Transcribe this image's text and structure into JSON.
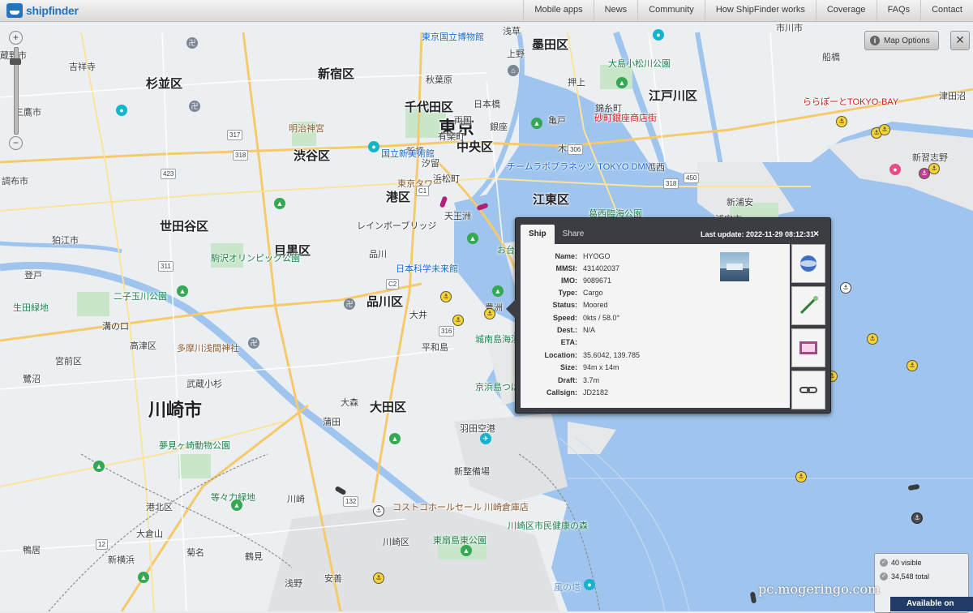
{
  "header": {
    "logo_text": "shipfinder",
    "nav": [
      "Mobile apps",
      "News",
      "Community",
      "How ShipFinder works",
      "Coverage",
      "FAQs",
      "Contact"
    ]
  },
  "map_controls": {
    "zoom_in": "+",
    "zoom_out": "−",
    "map_options_label": "Map Options",
    "map_options_info": "i",
    "close": "✕"
  },
  "map": {
    "wards": [
      "杉並区",
      "新宿区",
      "墨田区",
      "千代田区",
      "渋谷区",
      "中央区",
      "江戸川区",
      "世田谷区",
      "港区",
      "江東区",
      "目黒区",
      "品川区",
      "大田区"
    ],
    "major": [
      "東京",
      "川崎市"
    ],
    "labels": [
      "蔵野市",
      "吉祥寺",
      "三鷹市",
      "調布市",
      "狛江市",
      "登戸",
      "生田緑地",
      "溝の口",
      "高津区",
      "宮前区",
      "鷺沼",
      "武蔵小杉",
      "港北区",
      "鴨居",
      "新横浜",
      "大倉山",
      "菊名",
      "鶴見",
      "浅野",
      "安善",
      "蒲田",
      "大森",
      "羽田空港",
      "新整備場",
      "川崎",
      "川崎区",
      "市川市",
      "船橋",
      "津田沼",
      "新習志野",
      "浦安市",
      "新浦安",
      "葛西",
      "木場",
      "豊洲",
      "お台場",
      "品川",
      "大井",
      "平和島",
      "天王洲",
      "浜松町",
      "汐留",
      "新橋",
      "有楽町",
      "銀座",
      "日本橋",
      "秋葉原",
      "上野",
      "浅草",
      "押上",
      "錦糸町",
      "亀戸",
      "両国",
      "大島小松川公園",
      "葛西臨海公園",
      "城南島海浜公園",
      "京浜島つばさ公園",
      "東扇島東公園",
      "川崎区市民健康の森",
      "コストコホールセール 川崎倉庫店",
      "チームラボプラネッツ TOKYO DMM",
      "東京国立博物館",
      "国立新美術館",
      "明治神宮",
      "東京タワー",
      "レインボーブリッジ",
      "日本科学未来館",
      "ららぽーとTOKYO-BAY",
      "砂町銀座商店街",
      "駒沢オリンピック公園",
      "二子玉川公園",
      "夢見ヶ崎動物公園",
      "多摩川浅間神社",
      "等々力緑地",
      "風の塔"
    ],
    "status_count_visible": "40 visible",
    "status_count_total": "34,548 total",
    "available_on": "Available on",
    "watermark": "pc.mogeringo.com"
  },
  "popup": {
    "tabs": [
      "Ship",
      "Share"
    ],
    "last_update": "Last update: 2022-11-29 08:12:31",
    "close": "×",
    "fields": [
      {
        "k": "Name:",
        "v": "HYOGO"
      },
      {
        "k": "MMSI:",
        "v": "431402037"
      },
      {
        "k": "IMO:",
        "v": "9089671"
      },
      {
        "k": "Type:",
        "v": "Cargo"
      },
      {
        "k": "Status:",
        "v": "Moored"
      },
      {
        "k": "Speed:",
        "v": "0kts / 58.0°"
      },
      {
        "k": "Dest.:",
        "v": "N/A"
      },
      {
        "k": "ETA:",
        "v": ""
      },
      {
        "k": "Location:",
        "v": "35.6042, 139.785"
      },
      {
        "k": "Size:",
        "v": "94m x 14m"
      },
      {
        "k": "Draft:",
        "v": "3.7m"
      },
      {
        "k": "Callsign:",
        "v": "JD2182"
      }
    ]
  }
}
